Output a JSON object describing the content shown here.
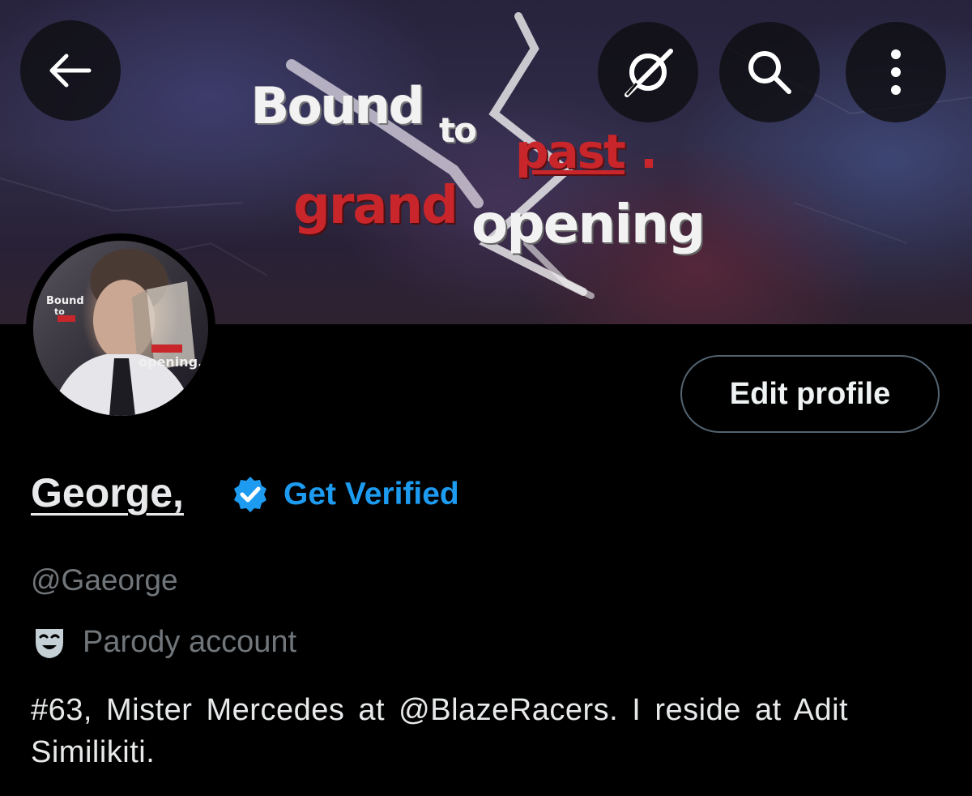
{
  "banner": {
    "text_bound": "Bound",
    "text_to": "to",
    "text_past": "past",
    "text_dot": ".",
    "text_grand": "grand",
    "text_opening": "opening"
  },
  "header": {
    "back_icon": "arrow-left-icon",
    "grok_icon": "grok-icon",
    "search_icon": "search-icon",
    "more_icon": "more-vertical-icon"
  },
  "avatar": {
    "text_bound": "Bound",
    "text_to": "to",
    "text_opening": "opening."
  },
  "profile": {
    "edit_label": "Edit profile",
    "name": "George,",
    "verified_icon": "verified-badge-icon",
    "get_verified_label": "Get Verified",
    "handle": "@Gaeorge",
    "parody_icon": "theater-mask-icon",
    "parody_label": "Parody account",
    "bio": "#63, Mister Mercedes at @BlazeRacers. I reside at Adit Similikiti."
  },
  "colors": {
    "background": "#000000",
    "accent": "#1d9bf0",
    "secondary_text": "#71767b",
    "primary_text": "#e7e9ea",
    "border": "#536471"
  }
}
